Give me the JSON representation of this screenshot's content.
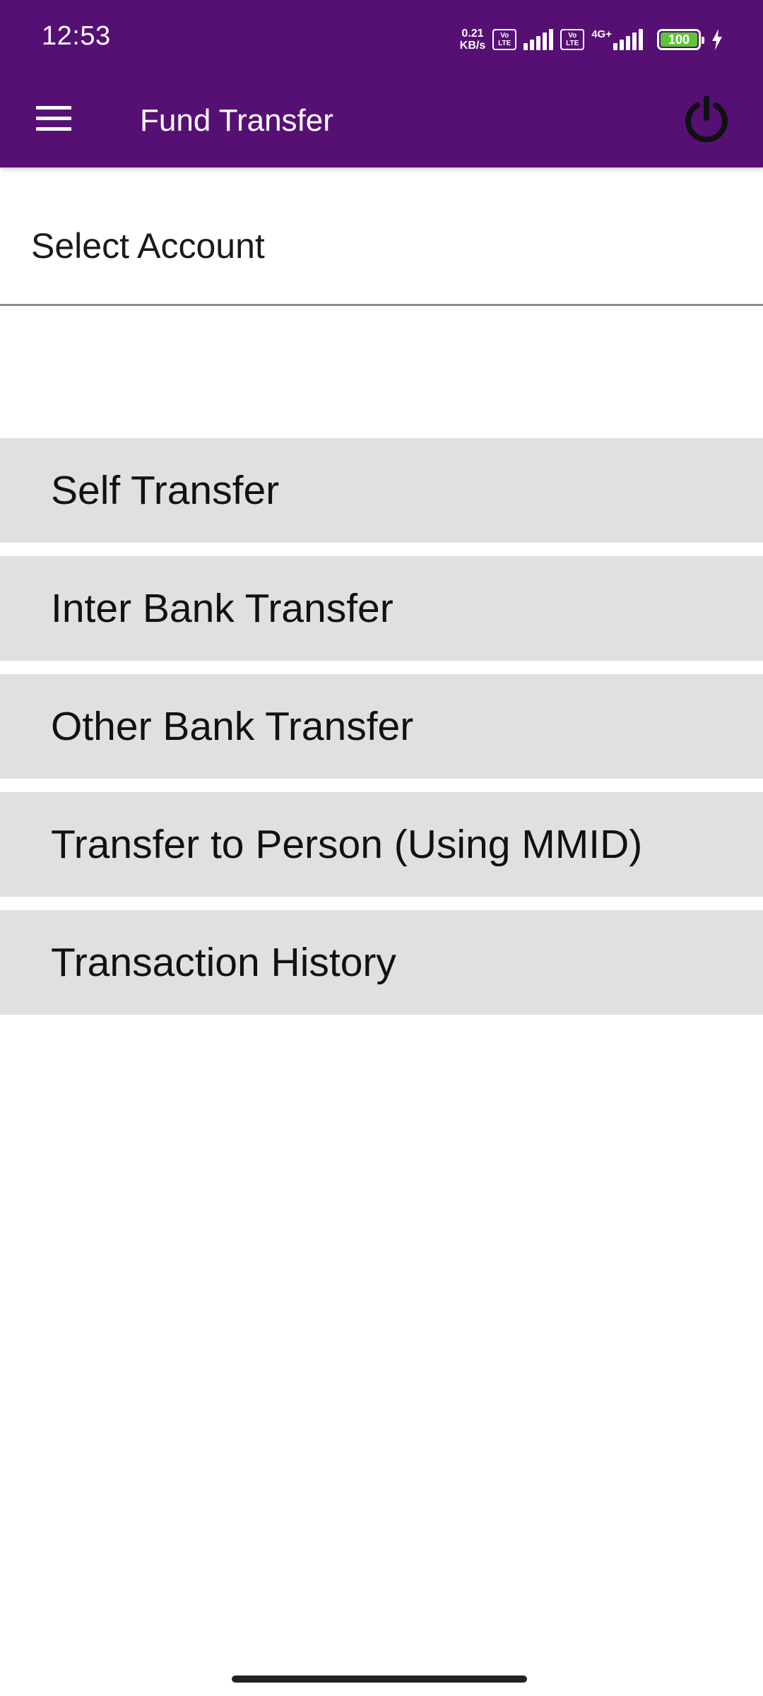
{
  "status_bar": {
    "time": "12:53",
    "net_speed_value": "0.21",
    "net_speed_unit": "KB/s",
    "volte_top": "Vo",
    "volte_bottom": "LTE",
    "network_type": "4G+",
    "battery_level": "100",
    "battery_fraction": 1.0,
    "battery_color": "#5ec43a"
  },
  "toolbar": {
    "title": "Fund Transfer",
    "menu_icon": "hamburger-menu-icon",
    "power_icon": "power-icon",
    "background_color": "#561074"
  },
  "account_selector": {
    "label": "Select Account"
  },
  "options": [
    {
      "label": "Self Transfer"
    },
    {
      "label": "Inter Bank Transfer"
    },
    {
      "label": "Other Bank Transfer"
    },
    {
      "label": "Transfer to Person (Using MMID)"
    },
    {
      "label": "Transaction History"
    }
  ],
  "colors": {
    "brand_purple": "#561074",
    "option_background": "#e0e0e0"
  }
}
